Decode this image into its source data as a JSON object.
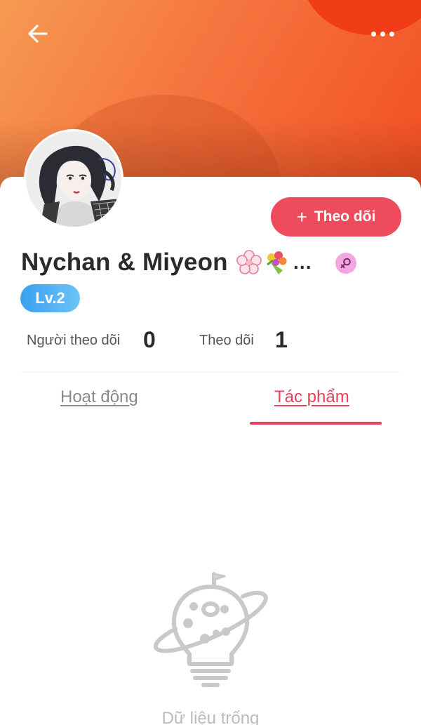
{
  "header": {
    "back_icon": "arrow-left-icon",
    "more_icon": "more-horizontal-icon",
    "banner_colors": [
      "#f79a52",
      "#f24e22"
    ]
  },
  "profile": {
    "name": "Nychan & Miyeon",
    "name_suffix": "…",
    "emoji_icons": [
      "cherry-blossom-emoji-icon",
      "bouquet-emoji-icon"
    ],
    "gender_icon": "female-symbol-icon",
    "level": "Lv.2",
    "follow_button": {
      "icon": "plus-icon",
      "label": "Theo dõi",
      "color": "#ee4b5d"
    }
  },
  "stats": {
    "followers_label": "Người theo dõi",
    "followers_count": "0",
    "following_label": "Theo dõi",
    "following_count": "1"
  },
  "tabs": {
    "activity": "Hoạt động",
    "works": "Tác phẩm",
    "active": "works",
    "active_color": "#e8405a"
  },
  "empty_state": {
    "icon": "planet-lightbulb-icon",
    "text": "Dữ liệu trống"
  }
}
